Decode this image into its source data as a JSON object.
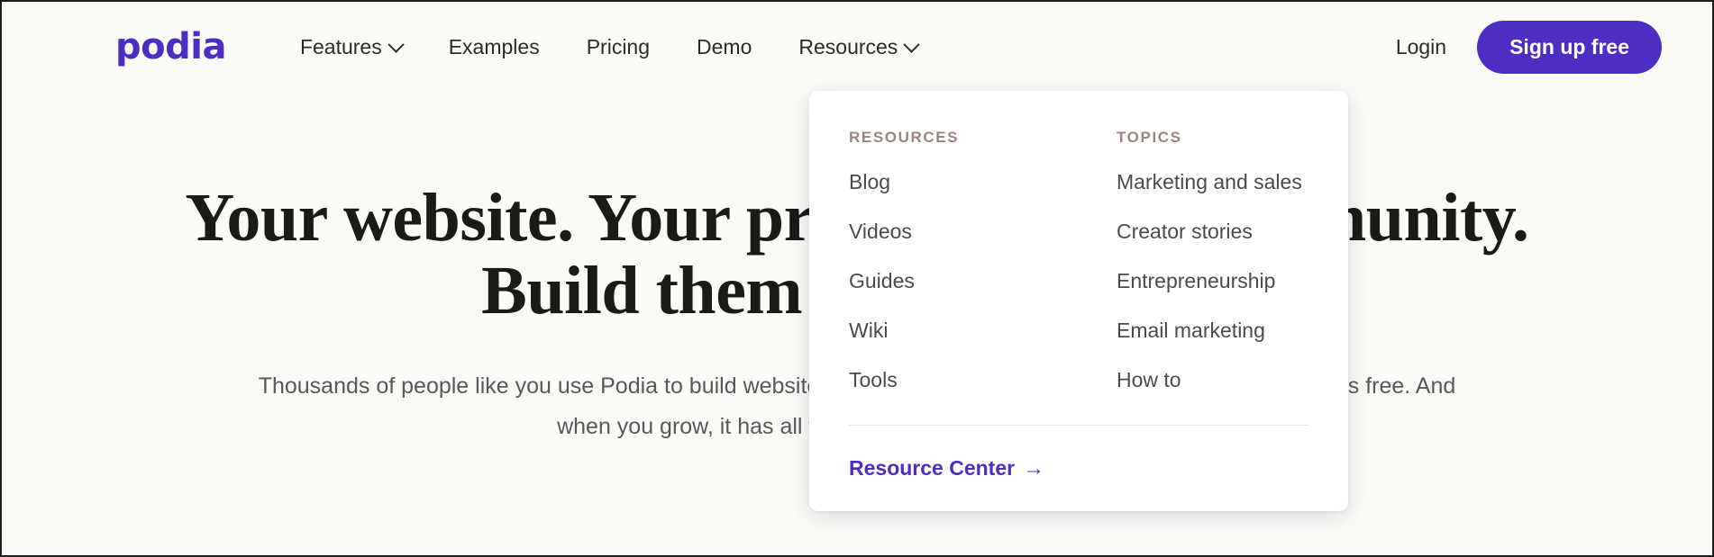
{
  "brand": {
    "logo_text": "podia",
    "accent_color": "#4e2ec2",
    "page_background": "#fbfaf7"
  },
  "header": {
    "nav": [
      {
        "label": "Features",
        "has_caret": true
      },
      {
        "label": "Examples",
        "has_caret": false
      },
      {
        "label": "Pricing",
        "has_caret": false
      },
      {
        "label": "Demo",
        "has_caret": false
      },
      {
        "label": "Resources",
        "has_caret": true
      }
    ],
    "login_label": "Login",
    "signup_label": "Sign up free"
  },
  "dropdown": {
    "open_for": "Resources",
    "columns": [
      {
        "heading": "RESOURCES",
        "items": [
          {
            "label": "Blog"
          },
          {
            "label": "Videos"
          },
          {
            "label": "Guides"
          },
          {
            "label": "Wiki"
          },
          {
            "label": "Tools"
          }
        ]
      },
      {
        "heading": "TOPICS",
        "items": [
          {
            "label": "Marketing and sales"
          },
          {
            "label": "Creator stories"
          },
          {
            "label": "Entrepreneurship"
          },
          {
            "label": "Email marketing"
          },
          {
            "label": "How to"
          }
        ]
      }
    ],
    "cta_label": "Resource Center",
    "cta_arrow": "→",
    "heading_color": "#9b8580",
    "cta_color": "#4e2ec2"
  },
  "hero": {
    "title_line_1": "Your website. Your products. Your community.",
    "title_line_2": "Build them all with Podia.",
    "subtitle_line_1": "Thousands of people like you use Podia to build websites, sell digital products, and host communities.",
    "subtitle_line_2": "Podia is free. And when you grow, it has all the tools you'll need along the way."
  }
}
